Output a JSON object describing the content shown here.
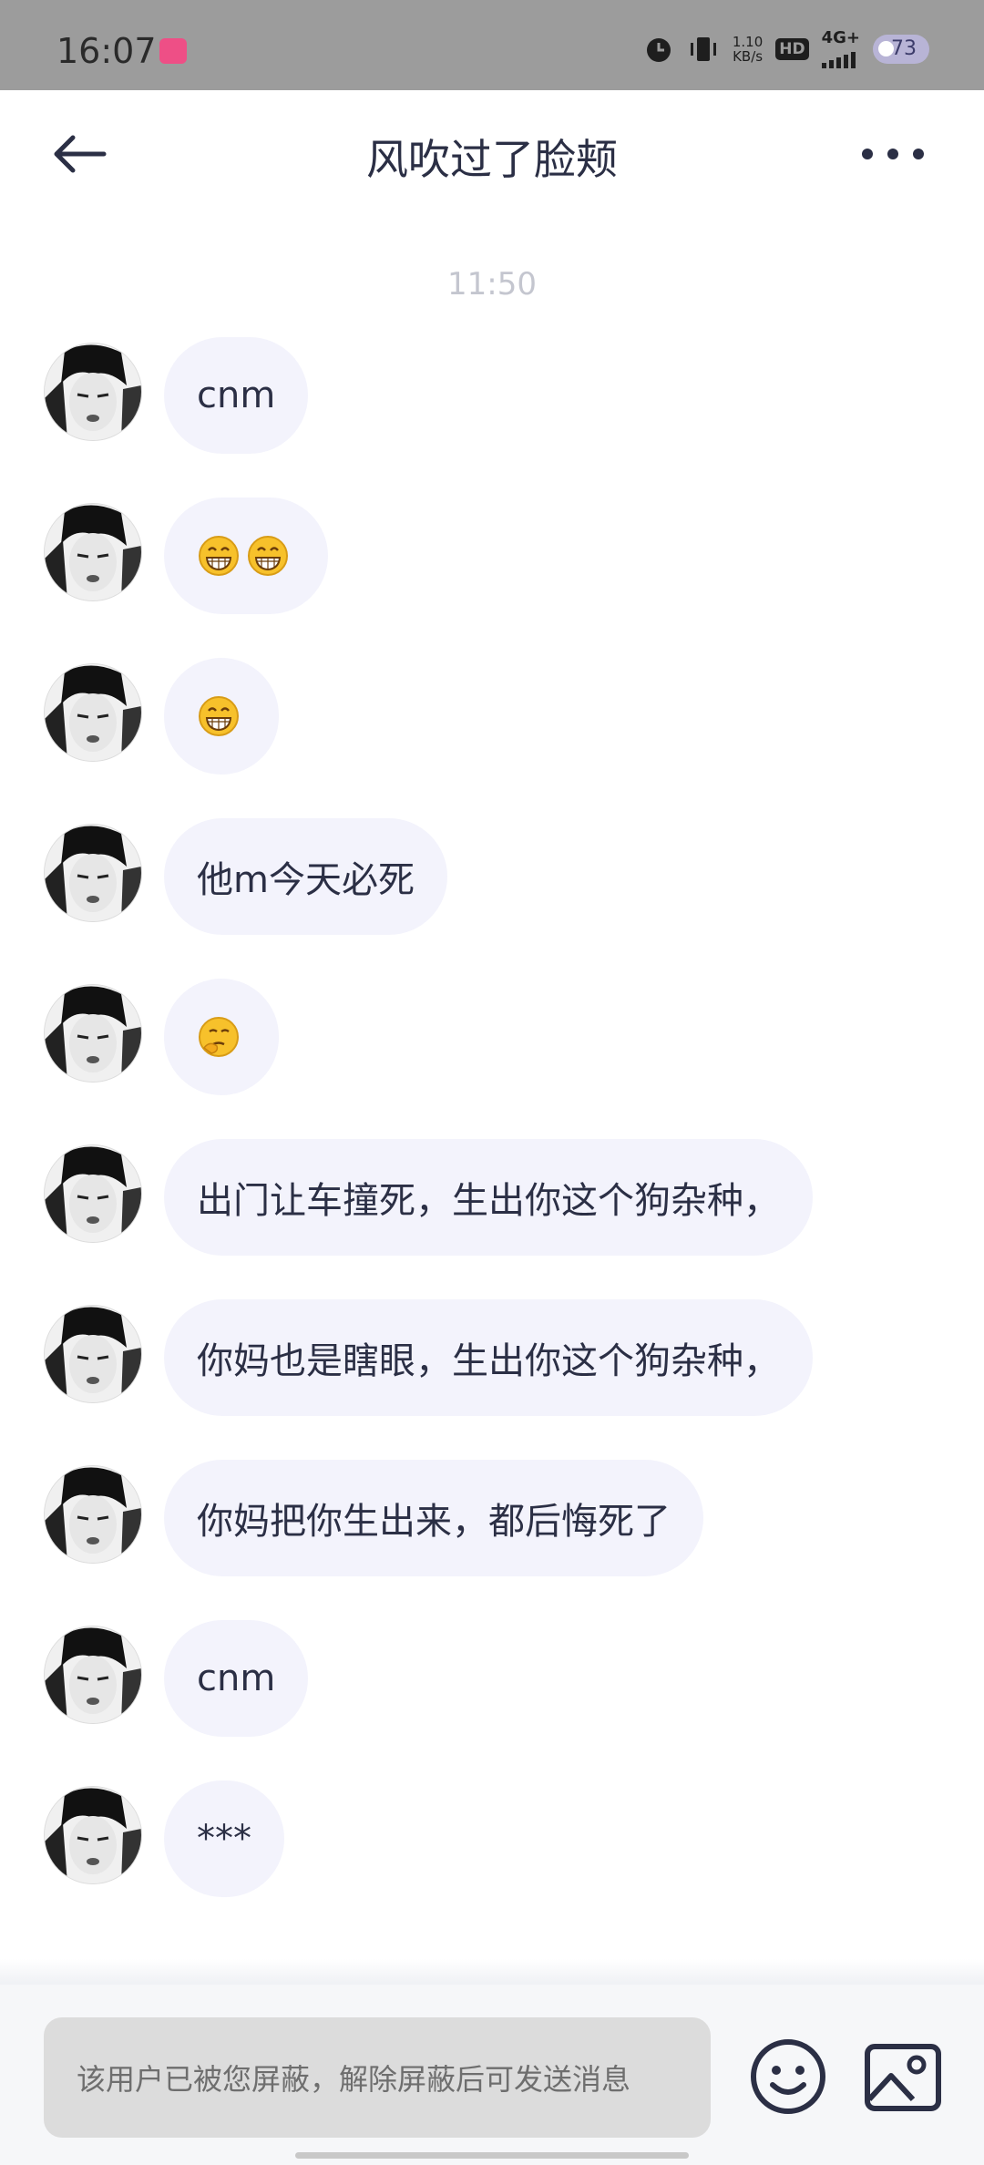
{
  "status_bar": {
    "time": "16:07",
    "net_speed_value": "1.10",
    "net_speed_unit": "KB/s",
    "hd_label": "HD",
    "network_label": "4G+",
    "battery": "73"
  },
  "header": {
    "title": "风吹过了脸颊"
  },
  "chat": {
    "timestamp": "11:50",
    "messages": [
      {
        "type": "text",
        "text": "cnm"
      },
      {
        "type": "emoji",
        "emoji": [
          "grin-emoji",
          "grin-emoji"
        ]
      },
      {
        "type": "emoji",
        "emoji": [
          "grin-emoji"
        ]
      },
      {
        "type": "text",
        "text": "他m今天必死"
      },
      {
        "type": "emoji",
        "emoji": [
          "thinking-emoji"
        ]
      },
      {
        "type": "text",
        "text": "出门让车撞死，生出你这个狗杂种，"
      },
      {
        "type": "text",
        "text": "你妈也是瞎眼，生出你这个狗杂种，"
      },
      {
        "type": "text",
        "text": "你妈把你生出来，都后悔死了"
      },
      {
        "type": "text",
        "text": "cnm"
      },
      {
        "type": "text",
        "text": "***"
      }
    ]
  },
  "composer": {
    "blocked_notice": "该用户已被您屏蔽，解除屏蔽后可发送消息"
  },
  "colors": {
    "bubble_bg": "#f3f3fc",
    "text": "#2b2f45",
    "status_bar_bg": "#9c9c9c"
  }
}
